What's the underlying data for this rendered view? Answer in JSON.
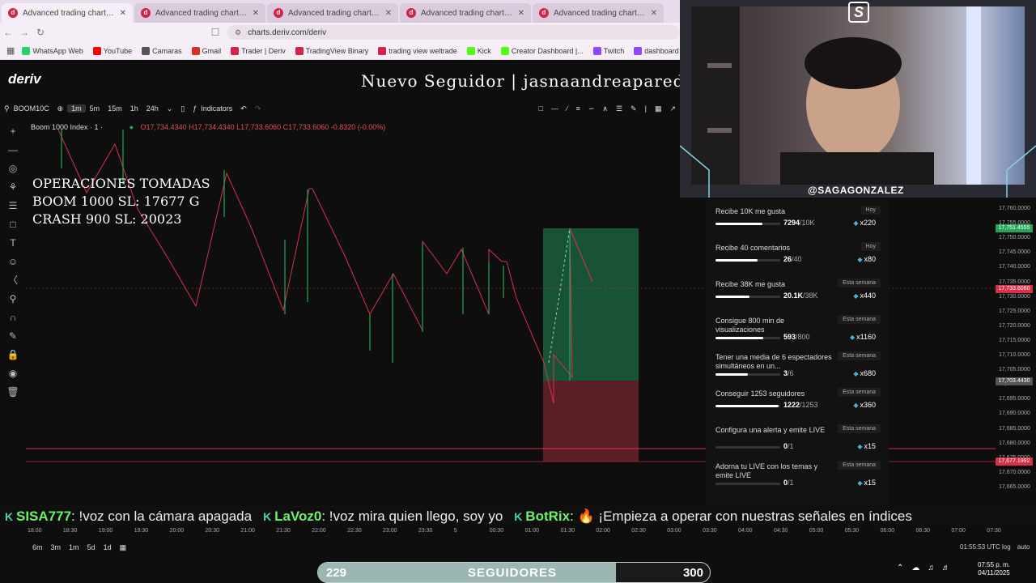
{
  "browser": {
    "tabs": [
      {
        "title": "Advanced trading charts & tools | Tr"
      },
      {
        "title": "Advanced trading charts & tools | Tr"
      },
      {
        "title": "Advanced trading charts & tools | Tr"
      },
      {
        "title": "Advanced trading charts & tools | Tr"
      },
      {
        "title": "Advanced trading charts & tools | Tr"
      }
    ],
    "url": "charts.deriv.com/deriv",
    "bookmarks": [
      {
        "label": "WhatsApp Web",
        "color": "#25d366"
      },
      {
        "label": "YouTube",
        "color": "#ff0000"
      },
      {
        "label": "Camaras",
        "color": "#555555"
      },
      {
        "label": "Gmail",
        "color": "#d93025"
      },
      {
        "label": "Trader | Deriv",
        "color": "#d4224a"
      },
      {
        "label": "TradingView Binary",
        "color": "#d4224a"
      },
      {
        "label": "trading view weltrade",
        "color": "#d4224a"
      },
      {
        "label": "Kick",
        "color": "#53fc18"
      },
      {
        "label": "Creator Dashboard |...",
        "color": "#53fc18"
      },
      {
        "label": "Twitch",
        "color": "#9146ff"
      },
      {
        "label": "dashboard twitch",
        "color": "#9146ff"
      }
    ]
  },
  "deriv": {
    "logo": "deriv",
    "follower_banner": "Nuevo Seguidor | jasnaandreaparede",
    "symbol": "BOOM10C",
    "timeframes": [
      "1m",
      "5m",
      "15m",
      "1h",
      "24h"
    ],
    "selected_timeframe": "1m",
    "indicators_label": "Indicators",
    "legend": {
      "name": "Boom 1000 Index · 1 ·",
      "ohlc": "O17,734.4340 H17,734.4340 L17,733.6060 C17,733.6060 -0.8320 (-0.00%)"
    },
    "operations_text": [
      "OPERACIONES TOMADAS",
      "BOOM 1000 SL: 17677 G",
      "CRASH 900 SL: 20023"
    ],
    "price_axis": [
      "17,760.0000",
      "17,755.0000",
      "17,750.0000",
      "17,745.0000",
      "17,740.0000",
      "17,735.0000",
      "17,730.0000",
      "17,725.0000",
      "17,720.0000",
      "17,715.0000",
      "17,710.0000",
      "17,705.0000",
      "17,700.0000",
      "17,695.0000",
      "17,690.0000",
      "17,685.0000",
      "17,680.0000",
      "17,675.0000",
      "17,670.0000",
      "17,665.0000"
    ],
    "price_tags": [
      {
        "value": "17,751.4555",
        "color": "#26a65b"
      },
      {
        "value": "17,733.6060",
        "color": "#d9304a"
      },
      {
        "value": "17,703.4430",
        "color": "#555555"
      },
      {
        "value": "17,677.1992",
        "color": "#d9304a"
      }
    ],
    "time_axis": [
      "18:00",
      "18:30",
      "19:00",
      "19:30",
      "20:00",
      "20:30",
      "21:00",
      "21:30",
      "22:00",
      "22:30",
      "23:00",
      "23:30",
      "5",
      "00:30",
      "01:00",
      "01:30",
      "02:00",
      "02:30",
      "03:00",
      "03:30",
      "04:00",
      "04:30",
      "05:00",
      "05:30",
      "06:00",
      "06:30",
      "07:00",
      "07:30"
    ],
    "ranges": [
      "6m",
      "3m",
      "1m",
      "5d",
      "1d"
    ],
    "utc_time": "01:55:53 UTC",
    "scale_log": "log",
    "scale_auto": "auto"
  },
  "webcam": {
    "handle": "@SAGAGONZALEZ",
    "logo": "S"
  },
  "goals": [
    {
      "name": "Recibe 10K me gusta",
      "period": "Hoy",
      "current": "7294",
      "target": "/10K",
      "reward": "x220",
      "fraction": 0.73
    },
    {
      "name": "Recibe 40 comentarios",
      "period": "Hoy",
      "current": "26",
      "target": "/40",
      "reward": "x80",
      "fraction": 0.65
    },
    {
      "name": "Recibe 38K me gusta",
      "period": "Esta semana",
      "current": "20.1K",
      "target": "/38K",
      "reward": "x440",
      "fraction": 0.53
    },
    {
      "name": "Consigue 800 min de visualizaciones",
      "period": "Esta semana",
      "current": "593",
      "target": "/800",
      "reward": "x1160",
      "fraction": 0.74
    },
    {
      "name": "Tener una media de 6 espectadores simultáneos en un...",
      "period": "Esta semana",
      "current": "3",
      "target": "/6",
      "reward": "x680",
      "fraction": 0.5
    },
    {
      "name": "Conseguir 1253 seguidores",
      "period": "Esta semana",
      "current": "1222",
      "target": "/1253",
      "reward": "x360",
      "fraction": 0.97
    },
    {
      "name": "Configura una alerta y emite LIVE",
      "period": "Esta semana",
      "current": "0",
      "target": "/1",
      "reward": "x15",
      "fraction": 0
    },
    {
      "name": "Adorna tu LIVE con los temas y emite LIVE",
      "period": "Esta semana",
      "current": "0",
      "target": "/1",
      "reward": "x15",
      "fraction": 0
    }
  ],
  "ticker": [
    {
      "user": "SISA777",
      "message": ": !voz con la cámara apagada"
    },
    {
      "user": "LaVoz0",
      "message": ": !voz mira quien llego, soy yo"
    },
    {
      "user": "BotRix",
      "message": ": 🔥 ¡Empieza a operar con nuestras señales en índices"
    }
  ],
  "followers": {
    "current": "229",
    "label": "SEGUIDORES",
    "goal": "300",
    "fraction": 0.76
  },
  "taskbar": {
    "time": "07:55 p. m.",
    "date": "04/11/2025"
  }
}
